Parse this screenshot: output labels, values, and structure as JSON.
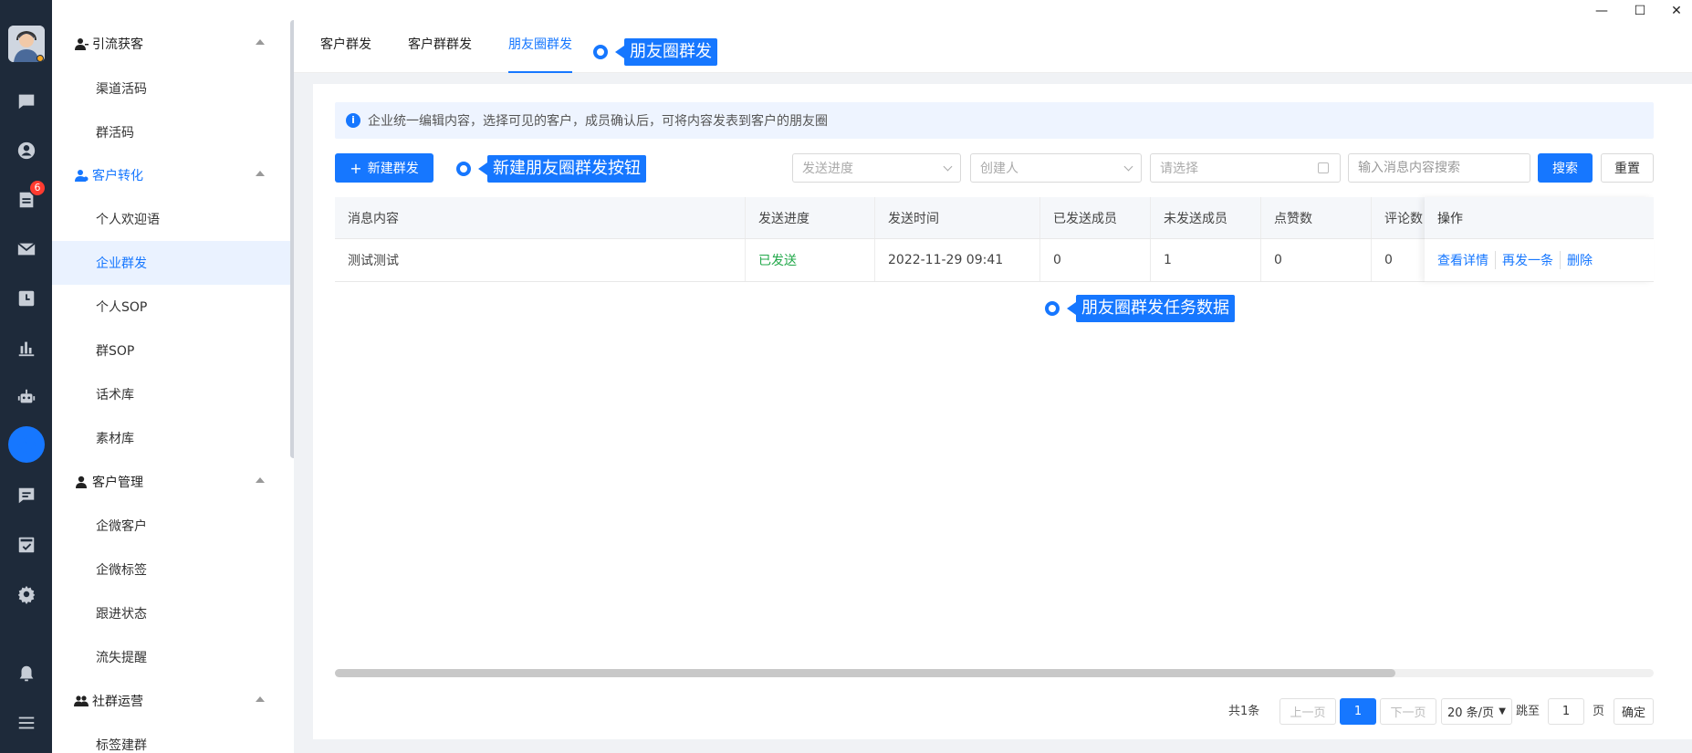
{
  "rail": {
    "badge_count": "6",
    "icons": [
      "chat-icon",
      "user-icon",
      "document-icon",
      "mail-icon",
      "clock-icon",
      "bar-chart-icon",
      "robot-icon",
      "moments-icon",
      "message-icon",
      "dashboard-icon",
      "gear-icon",
      "bell-icon",
      "menu-icon"
    ]
  },
  "sidebar": {
    "groups": [
      {
        "label": "引流获客",
        "items": [
          "渠道活码",
          "群活码"
        ]
      },
      {
        "label": "客户转化",
        "items": [
          "个人欢迎语",
          "企业群发",
          "个人SOP",
          "群SOP",
          "话术库",
          "素材库"
        ]
      },
      {
        "label": "客户管理",
        "items": [
          "企微客户",
          "企微标签",
          "跟进状态",
          "流失提醒"
        ]
      },
      {
        "label": "社群运营",
        "items": [
          "标签建群"
        ]
      }
    ]
  },
  "tabs": [
    "客户群发",
    "客户群群发",
    "朋友圈群发"
  ],
  "window_controls": {
    "minimize": "—",
    "maximize": "☐",
    "close": "✕"
  },
  "annotations": {
    "tab_note": "朋友圈群发",
    "button_note": "新建朋友圈群发按钮",
    "data_note": "朋友圈群发任务数据"
  },
  "info_banner": "企业统一编辑内容，选择可见的客户，成员确认后，可将内容发表到客户的朋友圈",
  "toolbar": {
    "new_button": "新建群发",
    "progress_placeholder": "发送进度",
    "creator_placeholder": "创建人",
    "date_placeholder": "请选择",
    "search_placeholder": "输入消息内容搜索",
    "search_button": "搜索",
    "reset_button": "重置"
  },
  "table": {
    "headers": [
      "消息内容",
      "发送进度",
      "发送时间",
      "已发送成员",
      "未发送成员",
      "点赞数",
      "评论数",
      "操作"
    ],
    "rows": [
      {
        "content": "测试测试",
        "status": "已发送",
        "time": "2022-11-29 09:41",
        "sent": "0",
        "unsent": "1",
        "likes": "0",
        "comments": "0"
      }
    ],
    "actions": [
      "查看详情",
      "再发一条",
      "删除"
    ],
    "status_color": "#22a84a"
  },
  "pagination": {
    "total": "共1条",
    "prev": "上一页",
    "current": "1",
    "next": "下一页",
    "page_size": "20 条/页",
    "jump_label": "跳至",
    "jump_value": "1",
    "page_unit": "页",
    "confirm": "确定"
  },
  "colors": {
    "accent": "#1677ff",
    "rail_bg": "#1e2a3a"
  }
}
